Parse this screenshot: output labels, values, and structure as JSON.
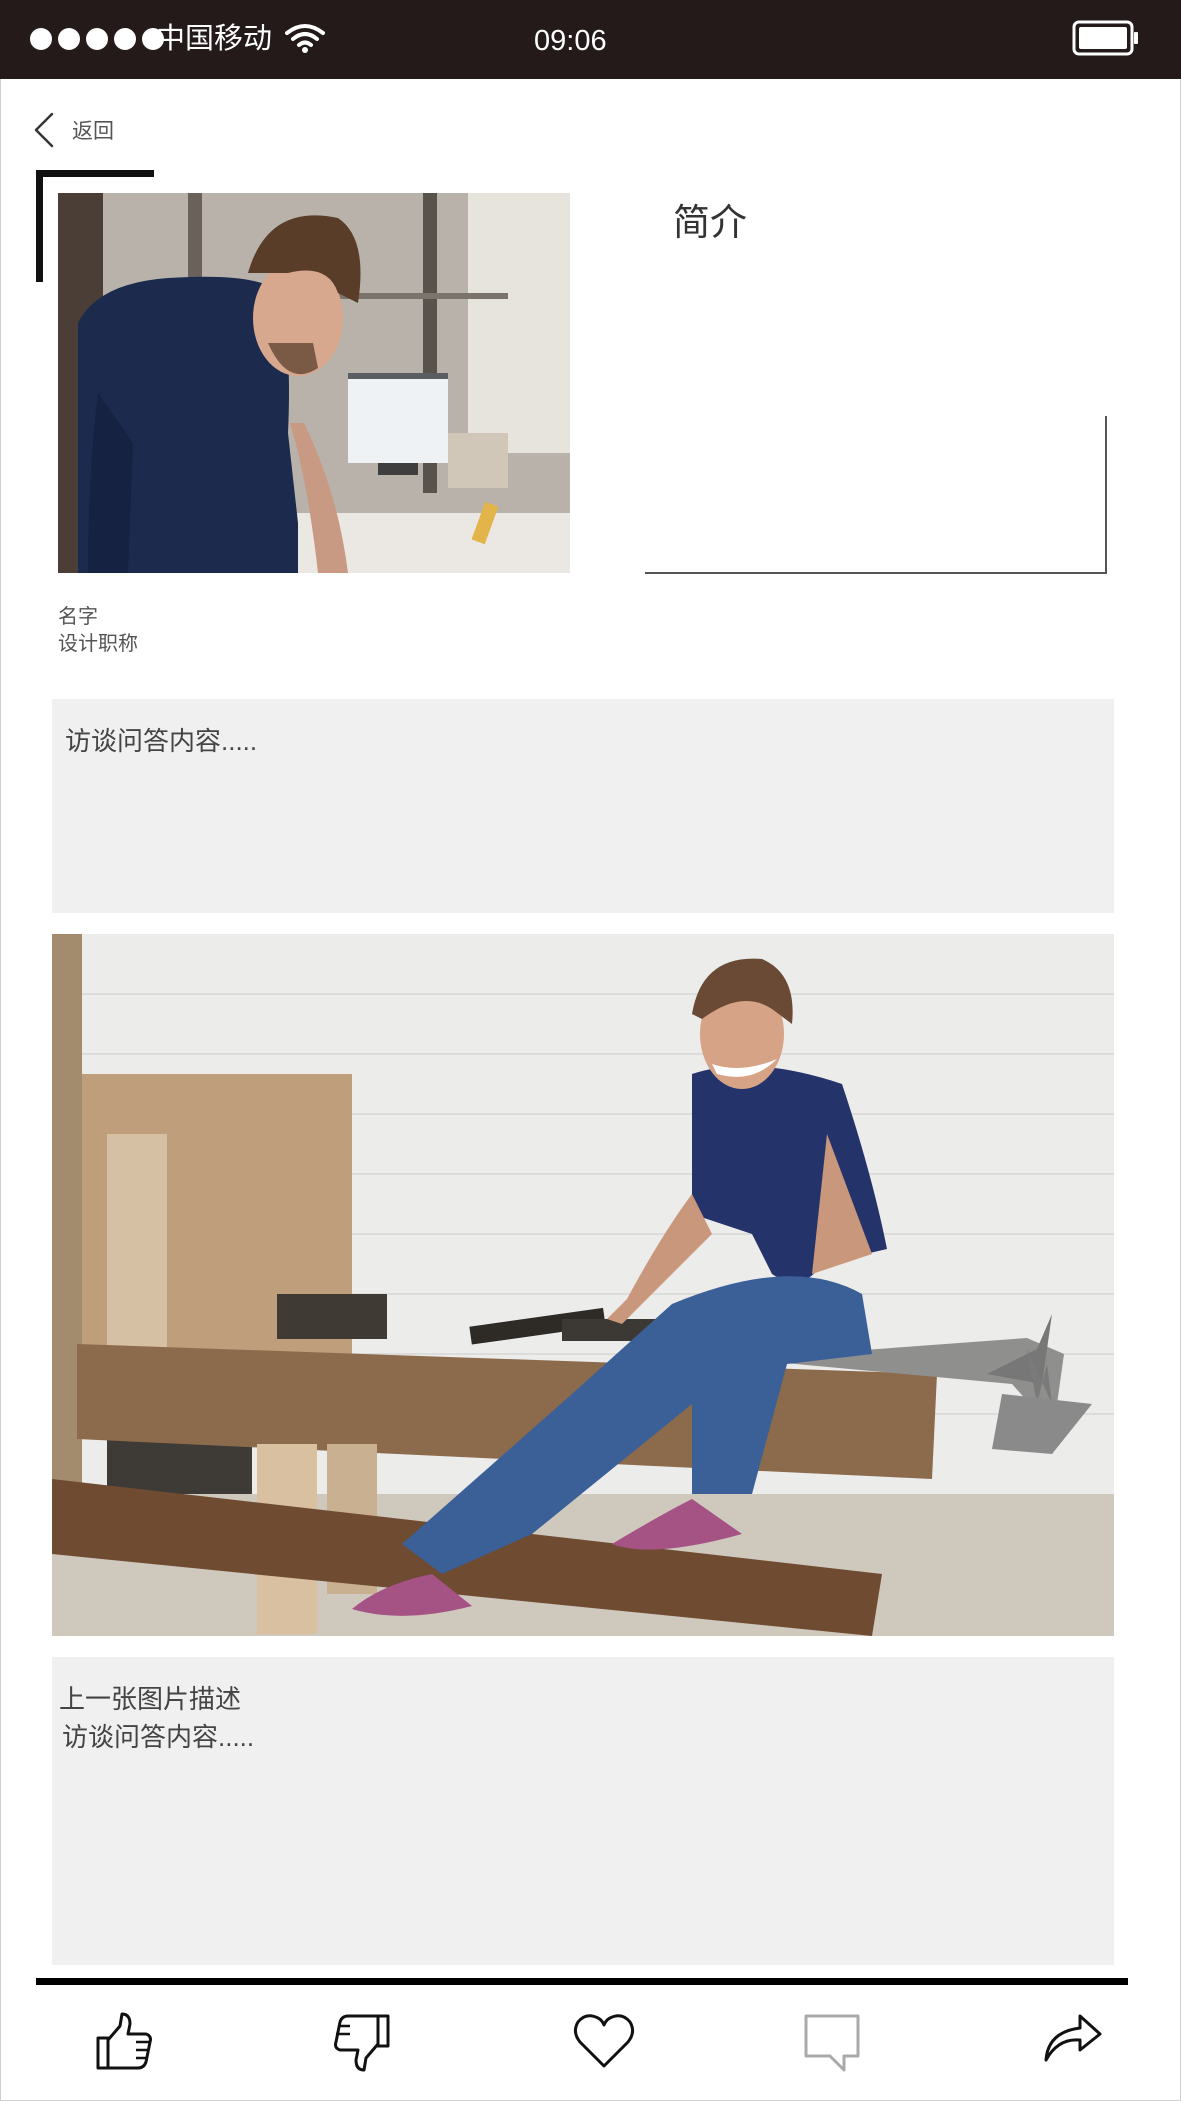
{
  "status_bar": {
    "carrier": "中国移动",
    "time": "09:06",
    "signal_bars": 5,
    "icons": [
      "wifi-icon",
      "battery-icon"
    ]
  },
  "nav": {
    "back_label": "返回",
    "back_icon": "chevron-left-icon"
  },
  "profile": {
    "intro_heading": "简介",
    "name": "名字",
    "job_title": "设计职称"
  },
  "interview": {
    "answer_1": "访谈问答内容.....",
    "image_caption": "上一张图片描述",
    "answer_2": "访谈问答内容....."
  },
  "actions": [
    {
      "name": "like",
      "icon": "thumbs-up-icon"
    },
    {
      "name": "dislike",
      "icon": "thumbs-down-icon"
    },
    {
      "name": "favorite",
      "icon": "heart-icon"
    },
    {
      "name": "comment",
      "icon": "comment-icon"
    },
    {
      "name": "share",
      "icon": "share-icon"
    }
  ],
  "colors": {
    "status_bar_bg": "#231a19",
    "panel_bg": "#f0f0f0",
    "text": "#333333",
    "comment_icon": "#aaaaaa"
  }
}
